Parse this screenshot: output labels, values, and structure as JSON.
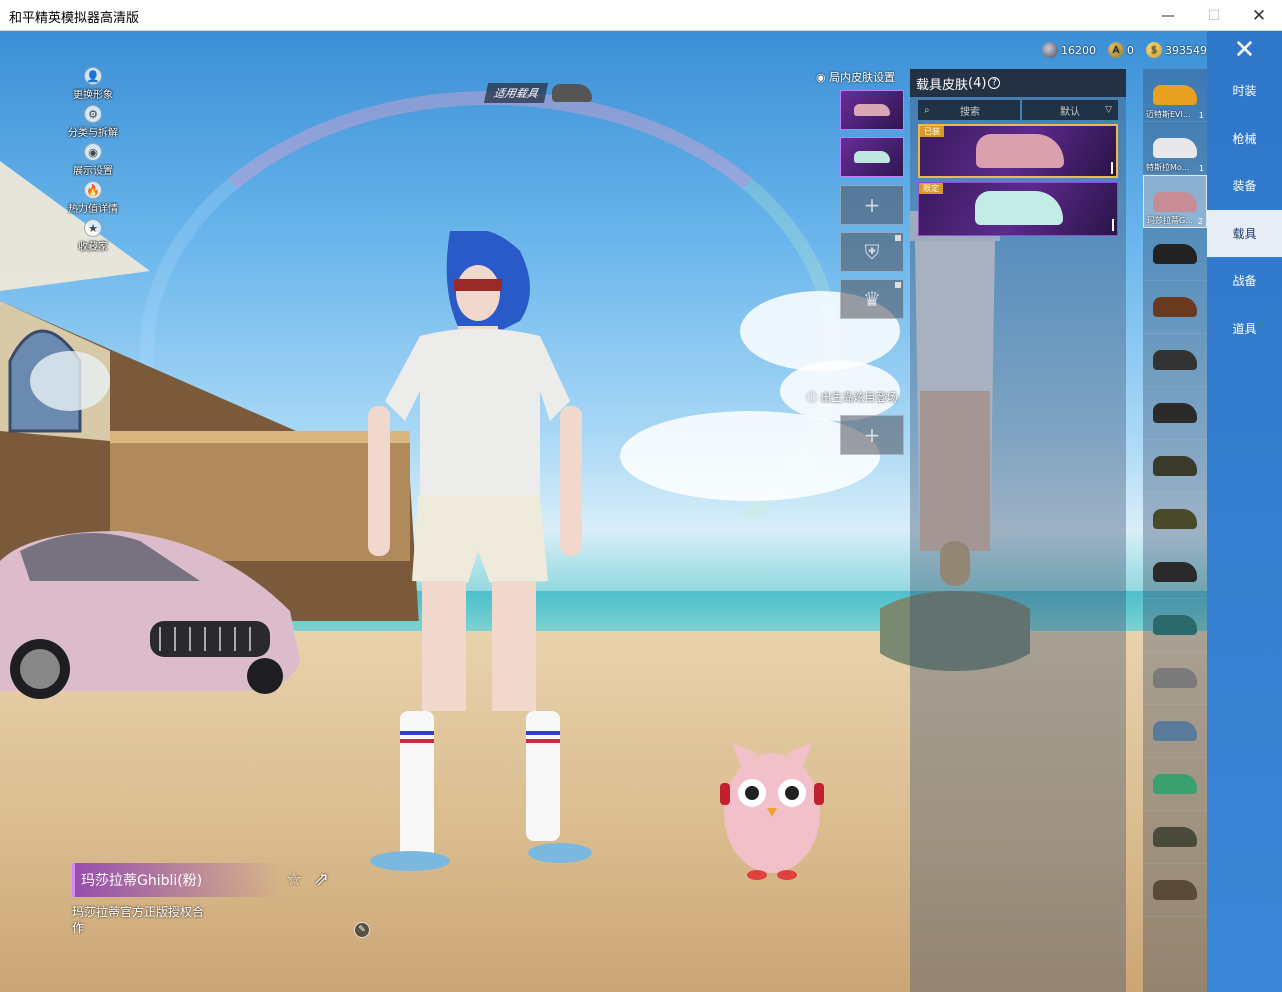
{
  "window": {
    "title": "和平精英模拟器高清版",
    "minimize_icon": "—",
    "maximize_icon": "☐",
    "close_icon": "✕"
  },
  "left_menu": [
    {
      "label": "更换形象",
      "icon": "person-icon",
      "glyph": "👤"
    },
    {
      "label": "分类与拆解",
      "icon": "tools-icon",
      "glyph": "⚙"
    },
    {
      "label": "展示设置",
      "icon": "eye-icon",
      "glyph": "◉"
    },
    {
      "label": "热力值详情",
      "icon": "flame-icon",
      "glyph": "🔥"
    },
    {
      "label": "收藏家",
      "icon": "medal-icon",
      "glyph": "★"
    }
  ],
  "currency": [
    {
      "icon": "gem-icon",
      "value": "16200",
      "color": "#556"
    },
    {
      "icon": "silver-coin-icon",
      "value": "0",
      "color": "#b08a30"
    },
    {
      "icon": "gold-coin-icon",
      "value": "393549",
      "color": "#e0b030"
    }
  ],
  "vehicle_tag": {
    "label": "适用载具"
  },
  "skin_settings": {
    "label": "局内皮肤设置",
    "slots": [
      {
        "type": "skin",
        "car_color": "#d9a6b3"
      },
      {
        "type": "skin",
        "car_color": "#bfe6e0"
      },
      {
        "type": "empty",
        "glyph": "+"
      },
      {
        "type": "locked",
        "glyph": "⛨"
      },
      {
        "type": "locked",
        "glyph": "♛"
      }
    ],
    "birth_island_label": "出生岛炫目登场",
    "birth_slot_glyph": "+"
  },
  "skin_panel": {
    "title": "载具皮肤",
    "count": "(4)",
    "help": "?",
    "search_placeholder": "搜索",
    "search_icon": "⌕",
    "sort_label": "默认",
    "sort_chevron": "▽",
    "cards": [
      {
        "badge": "已装",
        "car_color": "#dba0ad",
        "selected": true
      },
      {
        "badge": "限定",
        "car_color": "#c4ece6",
        "selected": false
      }
    ]
  },
  "vehicle_list": [
    {
      "name": "迈特斯EVI...",
      "count": "1",
      "color": "#e8a020"
    },
    {
      "name": "特斯拉Mo...",
      "count": "1",
      "color": "#e8e8ec"
    },
    {
      "name": "玛莎拉蒂G...",
      "count": "2",
      "color": "#c88c96"
    },
    {
      "name": "",
      "count": "",
      "color": "#222"
    },
    {
      "name": "",
      "count": "",
      "color": "#6a3a20"
    },
    {
      "name": "",
      "count": "",
      "color": "#333"
    },
    {
      "name": "",
      "count": "",
      "color": "#2a2a2a"
    },
    {
      "name": "",
      "count": "",
      "color": "#3a3a2a"
    },
    {
      "name": "",
      "count": "",
      "color": "#4a4a2a"
    },
    {
      "name": "",
      "count": "",
      "color": "#2a2a2a"
    },
    {
      "name": "",
      "count": "",
      "color": "#2a6a6a"
    },
    {
      "name": "",
      "count": "",
      "color": "#7a7a7a"
    },
    {
      "name": "",
      "count": "",
      "color": "#5a7a9a"
    },
    {
      "name": "",
      "count": "",
      "color": "#3aa070"
    },
    {
      "name": "",
      "count": "",
      "color": "#4a4a3a"
    },
    {
      "name": "",
      "count": "",
      "color": "#5a4a3a"
    }
  ],
  "categories": [
    {
      "label": "时装",
      "active": false
    },
    {
      "label": "枪械",
      "active": false
    },
    {
      "label": "装备",
      "active": false
    },
    {
      "label": "载具",
      "active": true
    },
    {
      "label": "战备",
      "active": false
    },
    {
      "label": "道具",
      "active": false
    }
  ],
  "close_glyph": "✕",
  "skin_info": {
    "name": "玛莎拉蒂Ghibli(粉)",
    "license": "玛莎拉蒂官方正版授权合作",
    "star_glyph": "☆",
    "share_glyph": "⇗",
    "small_btn_glyph": "✎"
  },
  "colors": {
    "accent_blue": "#2f77c9",
    "selected_border": "#f2b84a",
    "card_purple": "#5c2a8e"
  }
}
